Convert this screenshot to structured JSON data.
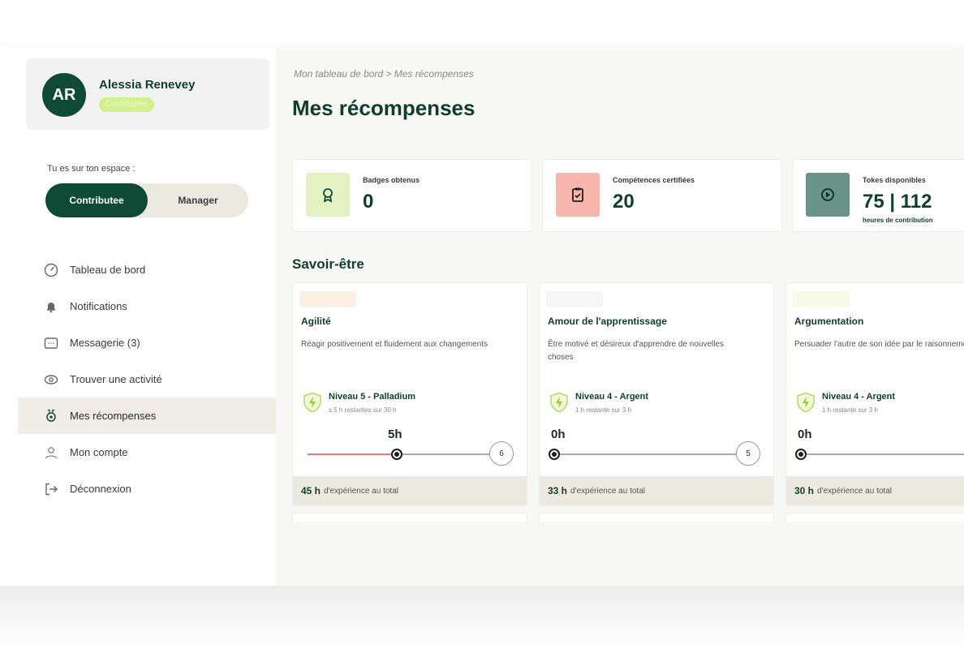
{
  "profile": {
    "initials": "AR",
    "name": "Alessia Renevey",
    "role": "Contributee"
  },
  "space": {
    "label": "Tu es sur ton espace :",
    "options": [
      "Contributee",
      "Manager"
    ],
    "selected": "Contributee"
  },
  "nav": [
    {
      "label": "Tableau de bord",
      "icon": "dashboard-gauge-icon",
      "active": false
    },
    {
      "label": "Notifications",
      "icon": "bell-icon",
      "active": false
    },
    {
      "label": "Messagerie (3)",
      "icon": "message-icon",
      "active": false
    },
    {
      "label": "Trouver une activité",
      "icon": "eye-icon",
      "active": false
    },
    {
      "label": "Mes récompenses",
      "icon": "award-icon",
      "active": true
    },
    {
      "label": "Mon compte",
      "icon": "user-icon",
      "active": false
    },
    {
      "label": "Déconnexion",
      "icon": "logout-icon",
      "active": false
    }
  ],
  "breadcrumb": "Mon tableau de bord > Mes récompenses",
  "page_title": "Mes récompenses",
  "stats": [
    {
      "label": "Badges obtenus",
      "value": "0",
      "icon": "ribbon-icon",
      "color": "#e4f2c3"
    },
    {
      "label": "Compétences certifiées",
      "value": "20",
      "icon": "clipboard-check-icon",
      "color": "#f6b5ad"
    },
    {
      "label": "Tokes disponibles",
      "value": "75 | 112",
      "sub": "heures de contribution",
      "icon": "token-icon",
      "color": "#6a9488"
    }
  ],
  "section_title": "Savoir-être",
  "skills": [
    {
      "title": "Agilité",
      "description": "Réagir positivement et fluidement aux changements",
      "level": "Niveau 5 - Palladium",
      "level_sub": "s 5 h restantes sur 30 h",
      "current_hours": "5h",
      "progress": 0.46,
      "target": "6",
      "total_hours": "45 h",
      "total_text": "d'expérience au total",
      "tag_color": "#fbf0e3"
    },
    {
      "title": "Amour de l'apprentissage",
      "description": "Être motivé et désireux d'apprendre de nouvelles choses",
      "level": "Niveau 4 - Argent",
      "level_sub": "1 h restante sur 3 h",
      "current_hours": "0h",
      "progress": 0.0,
      "target": "5",
      "total_hours": "33 h",
      "total_text": "d'expérience au total",
      "tag_color": "#f5f6f5"
    },
    {
      "title": "Argumentation",
      "description": "Persuader l'autre de son idée par le raisonnement",
      "level": "Niveau 4 - Argent",
      "level_sub": "1 h restante sur 3 h",
      "current_hours": "0h",
      "progress": 0.0,
      "target": "",
      "total_hours": "30 h",
      "total_text": "d'expérience au total",
      "tag_color": "#f8fae8"
    }
  ],
  "colors": {
    "primary": "#0f4a36",
    "accent": "#d2f08e",
    "progress": "#e77b6b",
    "footer": "#ece9e1"
  }
}
